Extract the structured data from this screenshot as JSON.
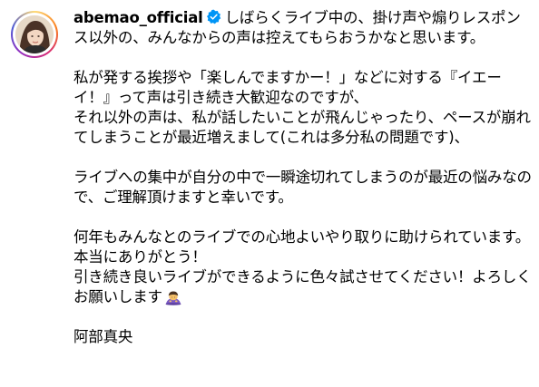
{
  "post": {
    "username": "abemao_official",
    "lead_text": "しばらくライブ中の、掛け声や煽りレスポンス以外の、みんなからの声は控えてもらおうかなと思います。",
    "paragraphs": [
      [
        "私が発する挨拶や「楽しんでますかー！」などに対する『イエーイ！』って声は引き続き大歓迎なのですが、",
        "それ以外の声は、私が話したいことが飛んじゃったり、ペースが崩れてしまうことが最近増えまして(これは多分私の問題です)、"
      ],
      [
        "ライブへの集中が自分の中で一瞬途切れてしまうのが最近の悩みなので、ご理解頂けますと幸いです。"
      ],
      [
        "何年もみんなとのライブでの心地よいやり取りに助けられています。本当にありがとう！",
        "引き続き良いライブができるように色々試させてください！よろしくお願いします"
      ]
    ],
    "signature": "阿部真央",
    "emoji_name": "bowing-person-emoji-icon",
    "verified_color": "#0095f6"
  }
}
